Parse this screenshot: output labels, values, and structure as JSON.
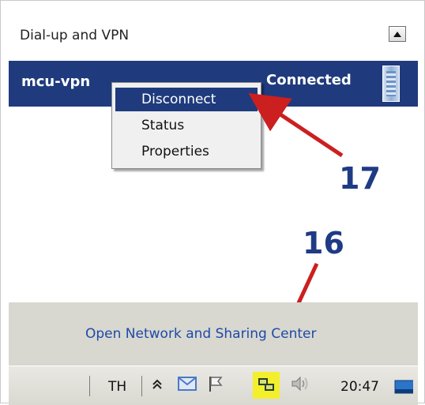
{
  "header": {
    "title": "Dial-up and VPN",
    "collapse_button_icon": "collapse-up-icon"
  },
  "connection": {
    "name": "mcu-vpn",
    "status": "Connected",
    "icon": "network-connection-icon",
    "highlight_color": "#1f3b7d"
  },
  "context_menu": {
    "items": [
      {
        "label": "Disconnect",
        "highlighted": true
      },
      {
        "label": "Status",
        "highlighted": false
      },
      {
        "label": "Properties",
        "highlighted": false
      }
    ]
  },
  "annotations": {
    "callout_17": "17",
    "callout_16": "16",
    "arrow_color": "#cc1f1f",
    "label_color": "#1f3b84"
  },
  "footer": {
    "link": "Open Network and Sharing Center"
  },
  "taskbar": {
    "language": "TH",
    "icons": [
      "show-hidden-icons-chevron",
      "mail-icon",
      "action-center-flag-icon",
      "network-icon",
      "volume-icon",
      "show-desktop-icon"
    ],
    "clock": "20:47"
  }
}
